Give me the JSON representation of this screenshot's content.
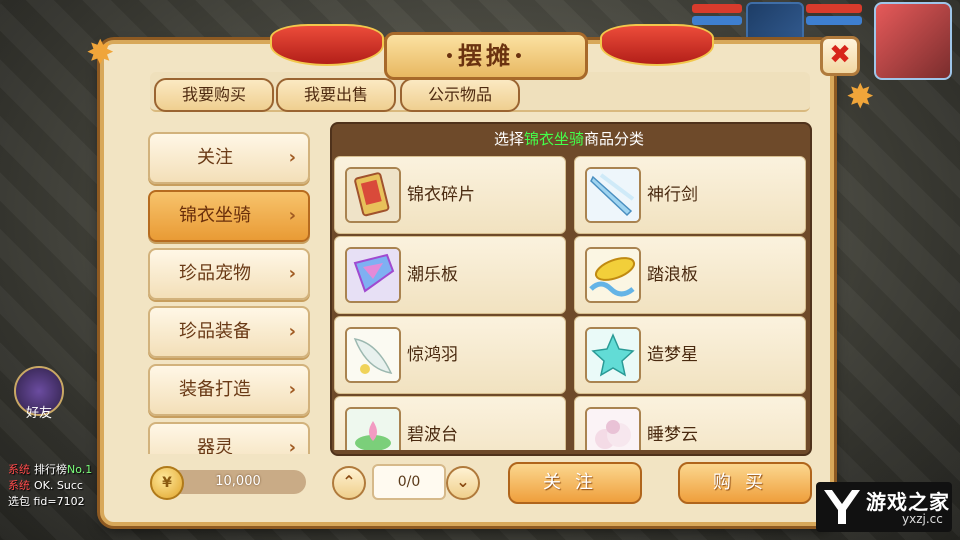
{
  "window": {
    "title": "摆摊",
    "close_label": "✖"
  },
  "tabs": [
    {
      "label": "我要购买"
    },
    {
      "label": "我要出售"
    },
    {
      "label": "公示物品"
    }
  ],
  "menu": [
    {
      "label": "关注",
      "active": false
    },
    {
      "label": "锦衣坐骑",
      "active": true
    },
    {
      "label": "珍品宠物",
      "active": false
    },
    {
      "label": "珍品装备",
      "active": false
    },
    {
      "label": "装备打造",
      "active": false
    },
    {
      "label": "器灵",
      "active": false
    }
  ],
  "arrow_glyph": "›",
  "header": {
    "prefix": "选择",
    "highlight": "锦衣坐骑",
    "suffix": "商品分类"
  },
  "items": [
    {
      "name": "锦衣碎片",
      "icon": "card-icon"
    },
    {
      "name": "神行剑",
      "icon": "sword-icon"
    },
    {
      "name": "潮乐板",
      "icon": "board-icon"
    },
    {
      "name": "踏浪板",
      "icon": "wave-board-icon"
    },
    {
      "name": "惊鸿羽",
      "icon": "feather-icon"
    },
    {
      "name": "造梦星",
      "icon": "star-icon"
    },
    {
      "name": "碧波台",
      "icon": "lotus-icon"
    },
    {
      "name": "睡梦云",
      "icon": "cloud-icon"
    }
  ],
  "currency": {
    "amount": "10,000"
  },
  "pager": {
    "up": "⌃",
    "down": "⌄",
    "value": "0/0"
  },
  "actions": {
    "follow": "关注",
    "buy": "购买"
  },
  "hud": {
    "friend_label": "好友",
    "chat": [
      {
        "tag": "系统",
        "text": "排行榜",
        "extra": "No.1"
      },
      {
        "tag": "系统",
        "text": "OK. Succ",
        "extra": ""
      },
      {
        "tag": "",
        "text": "选包 fid=7102",
        "extra": ""
      }
    ]
  },
  "logo": {
    "text": "游戏之家",
    "domain": "yxzj.cc"
  },
  "colors": {
    "accent": "#e99b35",
    "highlight_green": "#44ff4a",
    "close_red": "#d7241b"
  }
}
